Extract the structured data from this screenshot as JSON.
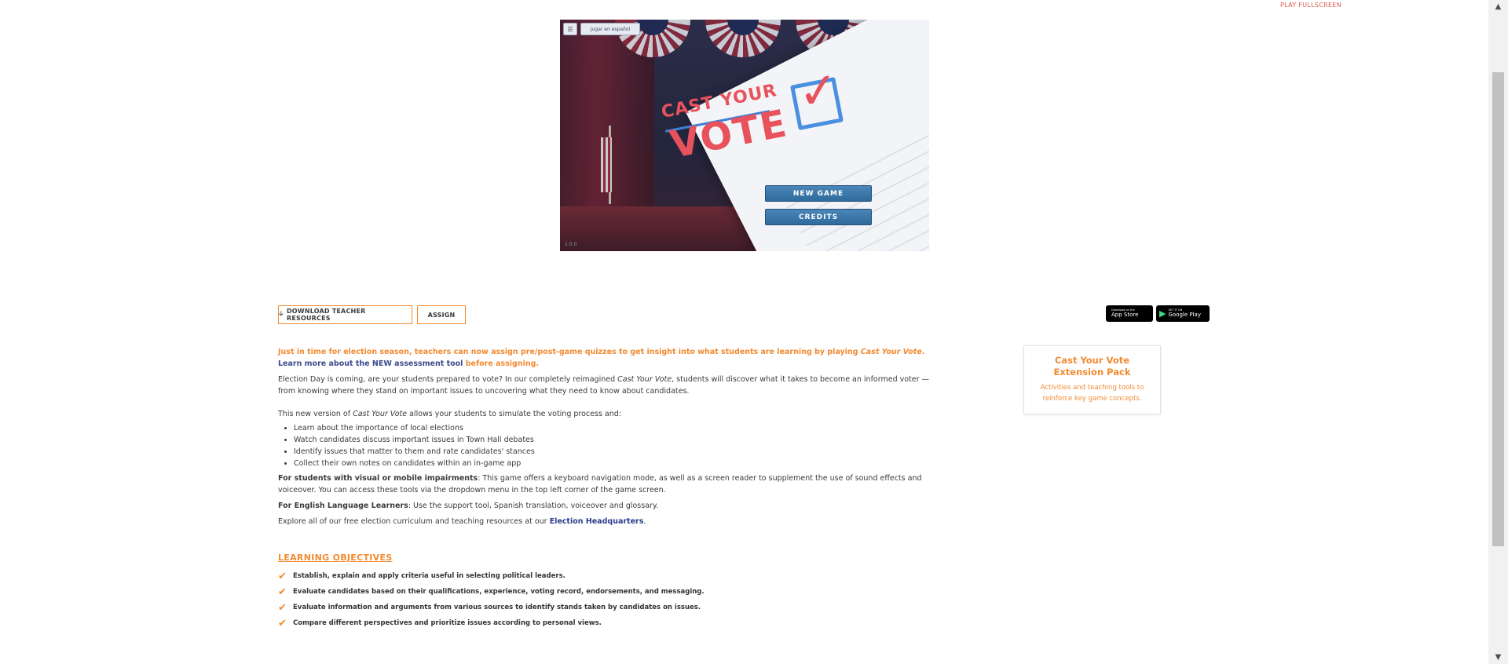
{
  "top_link": "PLAY FULLSCREEN",
  "game": {
    "menu_icon": "hamburger-icon",
    "spanish_button": "Jugar en español",
    "logo_line1": "CAST YOUR",
    "logo_line2": "VOTE",
    "new_game": "NEW GAME",
    "credits": "CREDITS",
    "footer": "1.0.0"
  },
  "actions": {
    "download_label": "DOWNLOAD TEACHER RESOURCES",
    "download_icon": "arrow-down-icon",
    "assign_label": "ASSIGN"
  },
  "store_badges": {
    "apple_small": "Download on the",
    "apple_big": "App Store",
    "google_small": "GET IT ON",
    "google_big": "Google Play"
  },
  "intro": {
    "text_before": "Just in time for election season, teachers can now assign pre/post-game quizzes to get insight into what students are learning by playing ",
    "game_name": "Cast Your Vote",
    "text_mid": ". ",
    "learn_link": "Learn more about the NEW assessment tool",
    "text_after": " before assigning."
  },
  "description": {
    "p1_before": "Election Day is coming, are your students prepared to vote? In our completely reimagined ",
    "p1_game": "Cast Your Vote",
    "p1_after": ", students will discover what it takes to become an informed voter — from knowing where they stand on important issues to uncovering what they need to know about candidates.",
    "p2_before": "This new version of ",
    "p2_game": "Cast Your Vote",
    "p2_after": " allows your students to simulate the voting process and:",
    "bullets": [
      "Learn about the importance of local elections",
      "Watch candidates discuss important issues in Town Hall debates",
      "Identify issues that matter to them and rate candidates' stances",
      "Collect their own notes on candidates within an in-game app"
    ],
    "access_label": "For students with visual or mobile impairments",
    "access_text": ": This game offers a keyboard navigation mode, as well as a screen reader to supplement the use of sound effects and voiceover. You can access these tools via the dropdown menu in the top left corner of the game screen.",
    "ell_label": "For English Language Learners",
    "ell_text": ": Use the support tool, Spanish translation, voiceover and glossary.",
    "explore_before": "Explore all of our free election curriculum and teaching resources at our ",
    "explore_link": "Election Headquarters",
    "explore_after": "."
  },
  "objectives": {
    "title": "LEARNING OBJECTIVES",
    "items": [
      "Establish, explain and apply criteria useful in selecting political leaders.",
      "Evaluate candidates based on their qualifications, experience, voting record, endorsements, and messaging.",
      "Evaluate information and arguments from various sources to identify stands taken by candidates on issues.",
      "Compare different perspectives and prioritize issues according to personal views."
    ]
  },
  "extension": {
    "title": "Cast Your Vote Extension Pack",
    "description": "Activities and teaching tools to reinforce key game concepts."
  },
  "colors": {
    "accent": "#f28a30",
    "link": "#2b3c8c",
    "fullscreen": "#e0564e"
  }
}
